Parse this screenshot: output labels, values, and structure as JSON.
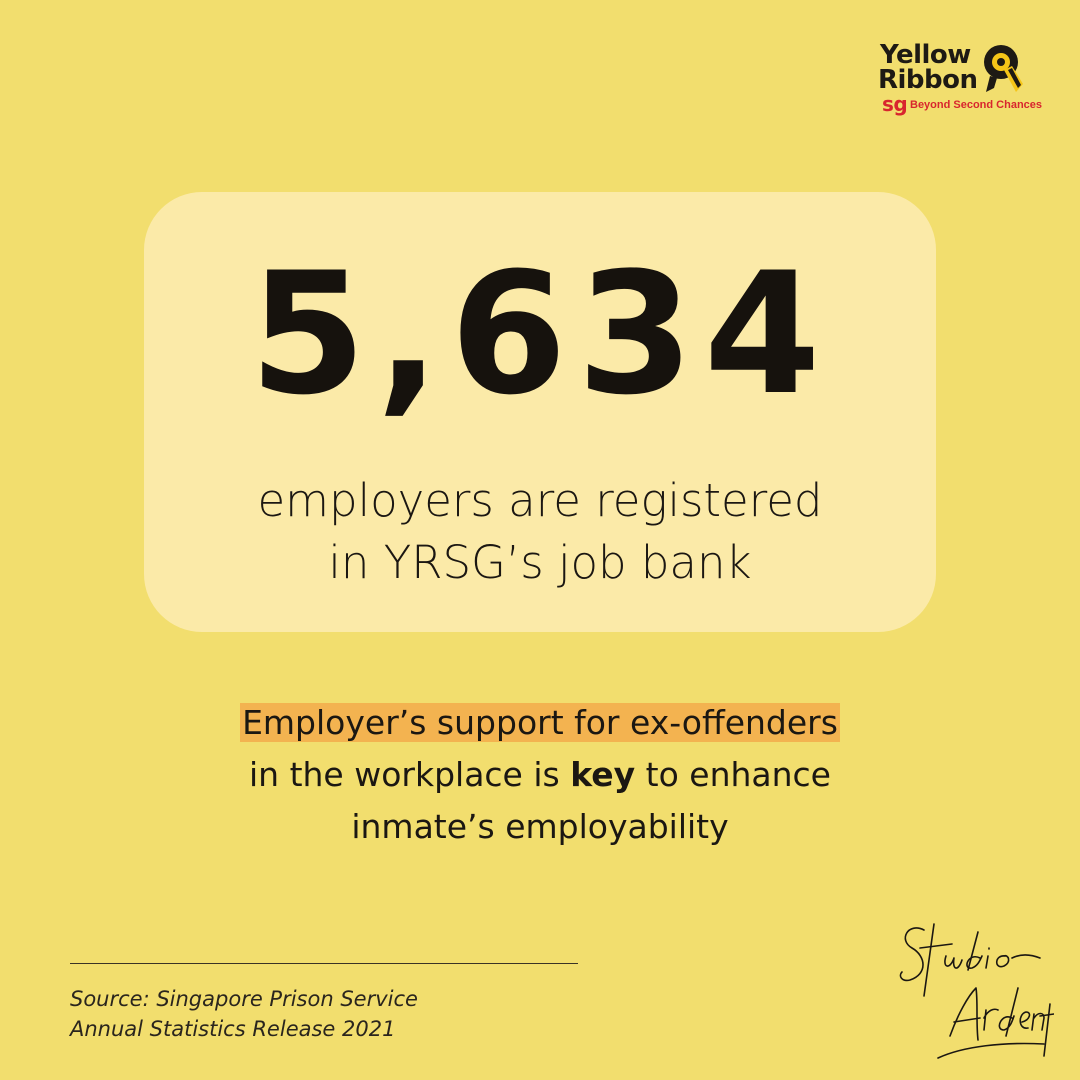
{
  "logo": {
    "line1": "Yellow",
    "line2": "Ribbon",
    "sg": "sg",
    "tagline": "Beyond Second Chances",
    "mark_icon": "yellow-ribbon-mark-icon"
  },
  "stat": {
    "number": "5,634",
    "caption_line1": "employers are registered",
    "caption_line2": "in YRSG’s job bank"
  },
  "message": {
    "line1_highlight": "Employer’s support for ex-offenders",
    "line2_before": "in the workplace is ",
    "line2_bold": "key",
    "line2_after": " to enhance",
    "line3": "inmate’s employability"
  },
  "source": {
    "line1": "Source: Singapore Prison Service",
    "line2": "Annual Statistics Release 2021"
  },
  "signature": {
    "text": "Studio Ardent",
    "icon": "studio-signature-icon"
  },
  "colors": {
    "background": "#f2de6e",
    "card": "#fbeaa8",
    "highlight": "#f3b350",
    "text": "#1b1712",
    "brand_red": "#d8262e"
  }
}
